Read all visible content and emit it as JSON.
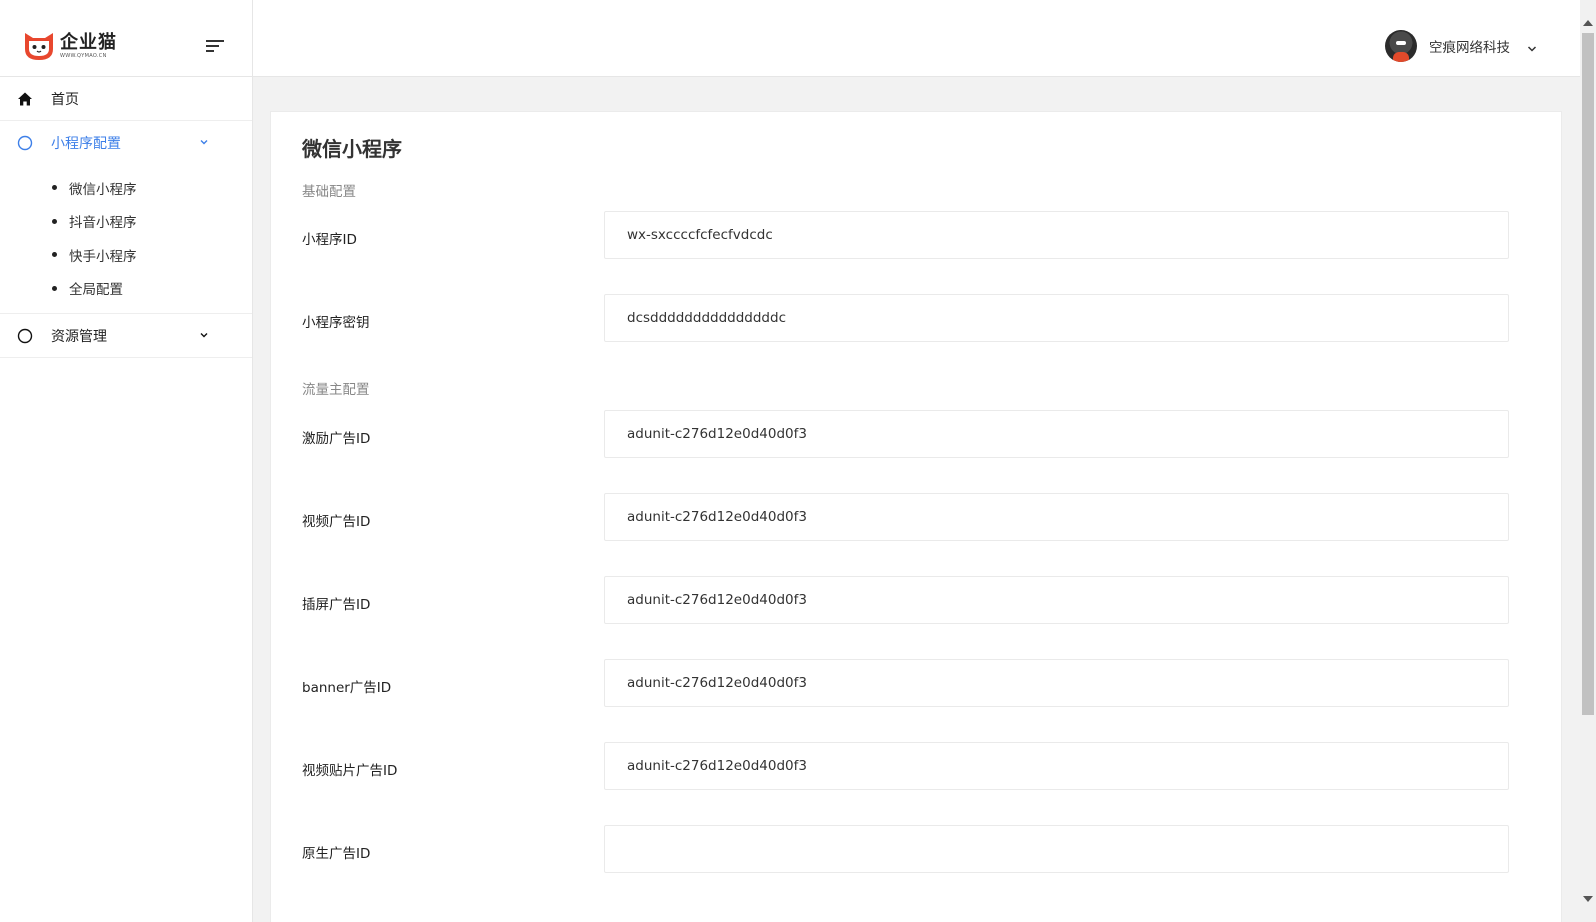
{
  "brand": {
    "name": "企业猫",
    "url": "WWW.QYMAO.CN"
  },
  "sidebar": {
    "home_label": "首页",
    "miniapp_label": "小程序配置",
    "sub_items": [
      "微信小程序",
      "抖音小程序",
      "快手小程序",
      "全局配置"
    ],
    "resource_label": "资源管理"
  },
  "header": {
    "user_name": "空痕网络科技"
  },
  "main": {
    "title": "微信小程序",
    "section_basic": "基础配置",
    "section_traffic": "流量主配置",
    "fields": [
      {
        "label": "小程序ID",
        "value": "wx-sxccccfcfecfvdcdc"
      },
      {
        "label": "小程序密钥",
        "value": "dcsdddddddddddddddc"
      },
      {
        "label": "激励广告ID",
        "value": "adunit-c276d12e0d40d0f3"
      },
      {
        "label": "视频广告ID",
        "value": "adunit-c276d12e0d40d0f3"
      },
      {
        "label": "插屏广告ID",
        "value": "adunit-c276d12e0d40d0f3"
      },
      {
        "label": "banner广告ID",
        "value": "adunit-c276d12e0d40d0f3"
      },
      {
        "label": "视频贴片广告ID",
        "value": "adunit-c276d12e0d40d0f3"
      },
      {
        "label": "原生广告ID",
        "value": ""
      }
    ]
  },
  "colors": {
    "accent": "#3d7fe8",
    "background": "#f2f2f2",
    "logo_red": "#e8472e"
  }
}
